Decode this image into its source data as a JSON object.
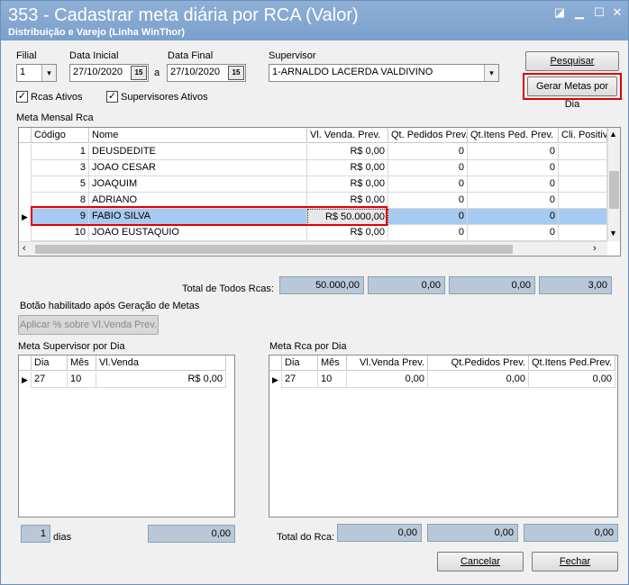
{
  "window": {
    "title": "353 - Cadastrar meta diária por RCA (Valor)",
    "subtitle": "Distribuição e Varejo (Linha WinThor)"
  },
  "filters": {
    "filial_label": "Filial",
    "filial_value": "1",
    "data_inicial_label": "Data Inicial",
    "data_inicial_value": "27/10/2020",
    "a_label": "a",
    "data_final_label": "Data Final",
    "data_final_value": "27/10/2020",
    "supervisor_label": "Supervisor",
    "supervisor_value": "1-ARNALDO LACERDA VALDIVINO",
    "cal_glyph": "15"
  },
  "buttons": {
    "pesquisar": "Pesquisar",
    "gerar": "Gerar Metas por Dia",
    "aplicar": "Aplicar % sobre Vl.Venda Prev.",
    "cancelar": "Cancelar",
    "fechar": "Fechar"
  },
  "checks": {
    "rcas": "Rcas Ativos",
    "supervisores": "Supervisores Ativos"
  },
  "meta_mensal": {
    "label": "Meta Mensal Rca",
    "headers": [
      "Código",
      "Nome",
      "Vl. Venda. Prev.",
      "Qt. Pedidos Prev.",
      "Qt.Itens Ped. Prev.",
      "Cli. Positiv"
    ],
    "rows": [
      {
        "codigo": "1",
        "nome": "DEUSDEDITE",
        "venda": "R$ 0,00",
        "pedidos": "0",
        "itens": "0"
      },
      {
        "codigo": "3",
        "nome": "JOAO CESAR",
        "venda": "R$ 0,00",
        "pedidos": "0",
        "itens": "0"
      },
      {
        "codigo": "5",
        "nome": "JOAQUIM",
        "venda": "R$ 0,00",
        "pedidos": "0",
        "itens": "0"
      },
      {
        "codigo": "8",
        "nome": "ADRIANO",
        "venda": "R$ 0,00",
        "pedidos": "0",
        "itens": "0"
      },
      {
        "codigo": "9",
        "nome": "FABIO SILVA",
        "venda": "R$ 50.000,00",
        "pedidos": "0",
        "itens": "0"
      },
      {
        "codigo": "10",
        "nome": "JOAO EUSTAQUIO",
        "venda": "R$ 0,00",
        "pedidos": "0",
        "itens": "0"
      }
    ]
  },
  "totais": {
    "label": "Total de Todos Rcas:",
    "venda": "50.000,00",
    "pedidos": "0,00",
    "itens": "0,00",
    "cli": "3,00"
  },
  "nota": "Botão habilitado após Geração de Metas",
  "meta_supervisor": {
    "label": "Meta Supervisor por Dia",
    "headers": [
      "Dia",
      "Mês",
      "Vl.Venda"
    ],
    "row": {
      "dia": "27",
      "mes": "10",
      "venda": "R$ 0,00"
    }
  },
  "meta_rca": {
    "label": "Meta Rca por Dia",
    "headers": [
      "Dia",
      "Mês",
      "Vl.Venda Prev.",
      "Qt.Pedidos Prev.",
      "Qt.Itens Ped.Prev."
    ],
    "row": {
      "dia": "27",
      "mes": "10",
      "venda": "0,00",
      "pedidos": "0,00",
      "itens": "0,00"
    }
  },
  "rodape": {
    "dias_value": "1",
    "dias_label": "dias",
    "sup_total": "0,00",
    "total_rca_label": "Total do Rca:",
    "rca_venda": "0,00",
    "rca_pedidos": "0,00",
    "rca_itens": "0,00"
  },
  "colors": {
    "titlebar": "#7aa0cc",
    "highlight": "#e00000",
    "selected_row": "#a6caf0",
    "total_field": "#b8c8d8"
  }
}
